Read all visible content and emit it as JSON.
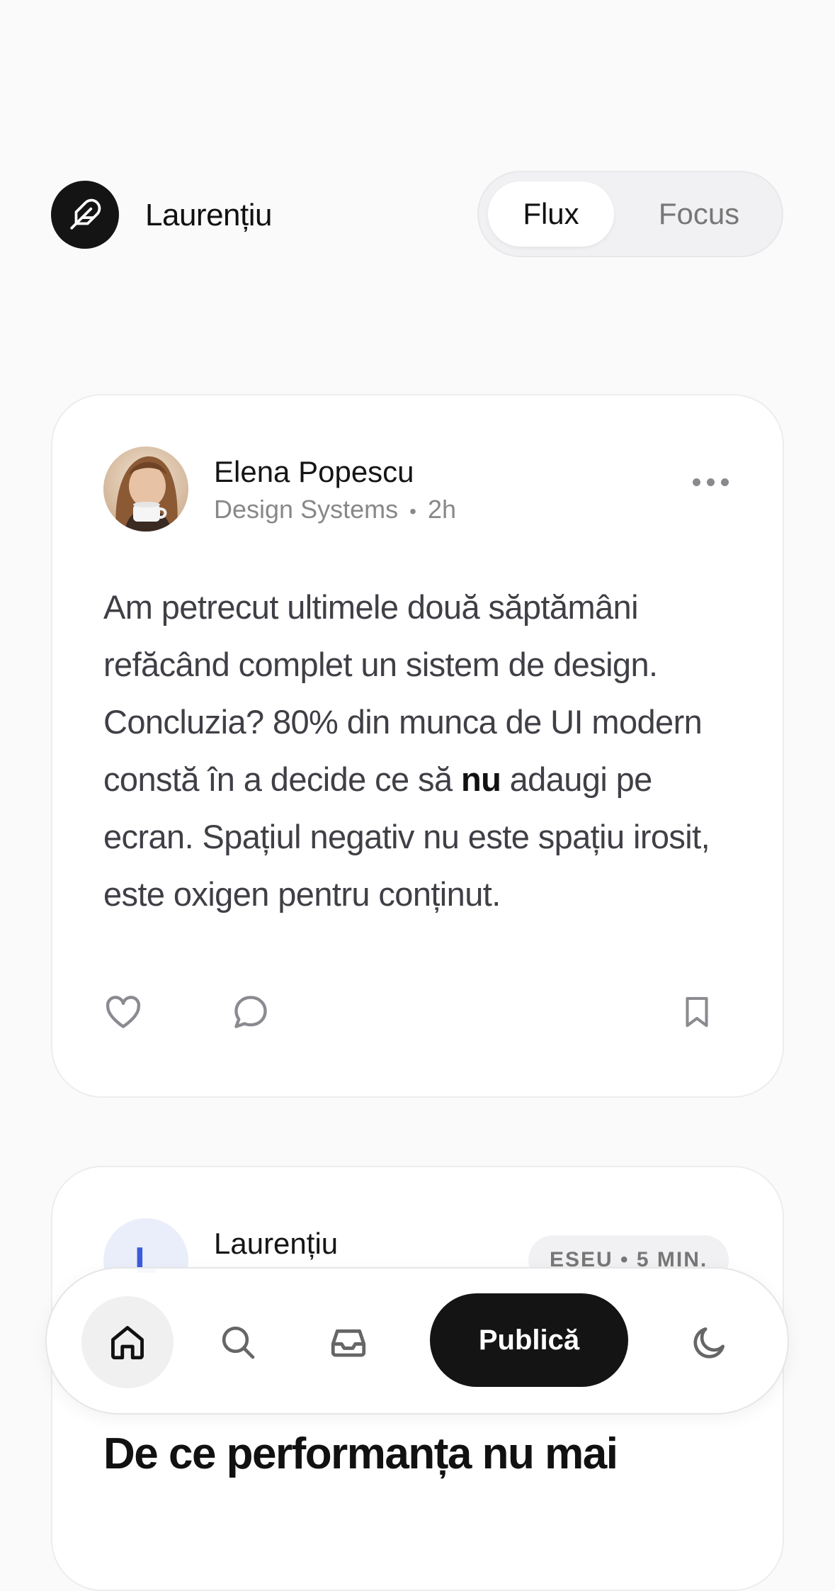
{
  "header": {
    "brand": "Laurențiu",
    "tabs": [
      {
        "label": "Flux",
        "active": true
      },
      {
        "label": "Focus",
        "active": false
      }
    ]
  },
  "posts": [
    {
      "author": "Elena Popescu",
      "topic": "Design Systems",
      "separator": "•",
      "time": "2h",
      "text_part1": "Am petrecut ultimele două săptămâni refăcând complet un sistem de design. Concluzia? 80% din munca de UI modern constă în a decide ce să ",
      "text_emphasis": "nu",
      "text_part2": " adaugi pe ecran. Spațiul negativ nu este spațiu irosit, este oxigen pentru conținut.",
      "actions": [
        "heart-icon",
        "comment-icon",
        "bookmark-icon"
      ]
    },
    {
      "author": "Laurențiu",
      "avatar_initial": "L",
      "badge": "ESEU • 5 MIN.",
      "title": "De ce performanța nu mai"
    }
  ],
  "bottom_nav": {
    "items": [
      "home-icon",
      "search-icon",
      "inbox-icon",
      "moon-icon"
    ],
    "publish_label": "Publică"
  },
  "colors": {
    "background": "#fafafa",
    "card": "#ffffff",
    "primary_dark": "#141414",
    "muted_text": "#888888",
    "accent_initial": "#3b5bdb"
  }
}
